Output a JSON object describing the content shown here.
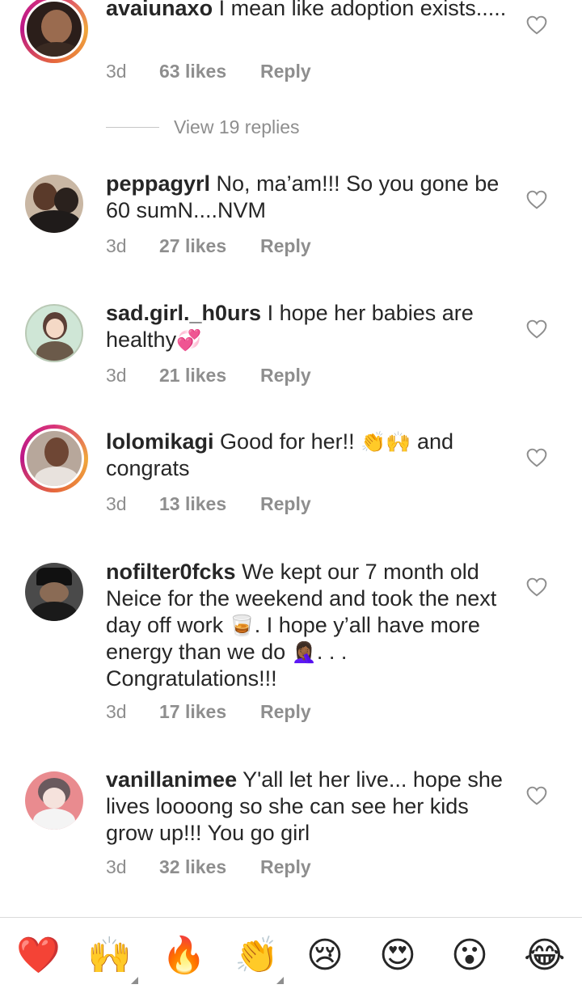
{
  "comments": [
    {
      "username": "avaiunaxo",
      "text": "I mean like adoption exists.....",
      "time": "3d",
      "likes": "63 likes",
      "reply": "Reply",
      "view_replies": "View 19 replies"
    },
    {
      "username": "peppagyrl",
      "text": "No, ma’am!!! So you gone be 60 sumN....NVM",
      "time": "3d",
      "likes": "27 likes",
      "reply": "Reply"
    },
    {
      "username": "sad.girl._h0urs",
      "text": "I hope her babies are healthy",
      "emoji": "💞",
      "time": "3d",
      "likes": "21 likes",
      "reply": "Reply"
    },
    {
      "username": "lolomikagi",
      "text_a": "Good for her!!",
      "emoji": "👏🙌",
      "text_b": "and congrats",
      "time": "3d",
      "likes": "13 likes",
      "reply": "Reply"
    },
    {
      "username": "nofilter0fcks",
      "text_a": "We kept our 7 month old Neice for the weekend and took the next day off work",
      "emoji_a": "🥃",
      "text_b": ". I hope y’all have more energy than we do",
      "emoji_b": "🤦🏾‍♀️",
      "text_c": ". . . Congratulations!!!",
      "time": "3d",
      "likes": "17 likes",
      "reply": "Reply"
    },
    {
      "username": "vanillanimee",
      "text": "Y'all let her live... hope she lives loooong so she can see her kids grow up!!! You go girl",
      "time": "3d",
      "likes": "32 likes",
      "reply": "Reply"
    }
  ],
  "reaction_bar": [
    {
      "emoji": "❤️",
      "icon": "red-heart-icon"
    },
    {
      "emoji": "🙌",
      "icon": "raising-hands-icon"
    },
    {
      "emoji": "🔥",
      "icon": "fire-icon"
    },
    {
      "emoji": "👏",
      "icon": "clapping-hands-icon"
    },
    {
      "emoji": "😢",
      "icon": "crying-face-icon"
    },
    {
      "emoji": "😍",
      "icon": "heart-eyes-icon"
    },
    {
      "emoji": "😮",
      "icon": "astonished-face-icon"
    },
    {
      "emoji": "😂",
      "icon": "tears-of-joy-icon"
    }
  ],
  "colors": {
    "text": "#262626",
    "secondary": "#8e8e8e",
    "story_ring_start": "#d8337a",
    "story_ring_end": "#f0a73c"
  }
}
